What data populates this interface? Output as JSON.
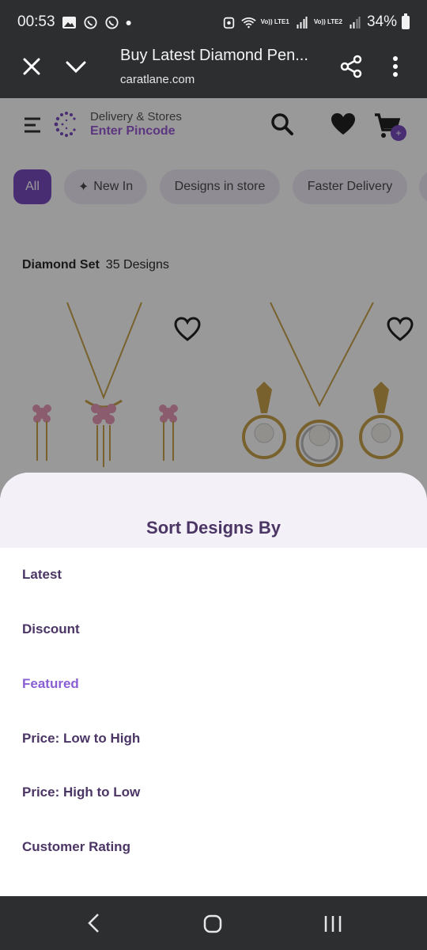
{
  "status_bar": {
    "time": "00:53",
    "lte1": "Vo)) LTE1",
    "lte2": "Vo)) LTE2",
    "battery": "34%"
  },
  "toolbar": {
    "title": "Buy Latest Diamond Pen...",
    "url": "caratlane.com"
  },
  "header": {
    "delivery_label": "Delivery & Stores",
    "pincode_link": "Enter Pincode",
    "cart_count": "+"
  },
  "chips": [
    {
      "label": "All",
      "active": true
    },
    {
      "label": "New In",
      "active": false
    },
    {
      "label": "Designs in store",
      "active": false
    },
    {
      "label": "Faster Delivery",
      "active": false
    }
  ],
  "results": {
    "category": "Diamond Set",
    "count": "35 Designs"
  },
  "sheet": {
    "title": "Sort Designs By",
    "options": [
      {
        "label": "Latest",
        "selected": false
      },
      {
        "label": "Discount",
        "selected": false
      },
      {
        "label": "Featured",
        "selected": true
      },
      {
        "label": "Price: Low to High",
        "selected": false
      },
      {
        "label": "Price: High to Low",
        "selected": false
      },
      {
        "label": "Customer Rating",
        "selected": false
      }
    ]
  },
  "colors": {
    "accent": "#7b4cc0",
    "selected_option": "#8a5fd4",
    "option_text": "#4b3565",
    "system_bar": "#2d2e30"
  }
}
